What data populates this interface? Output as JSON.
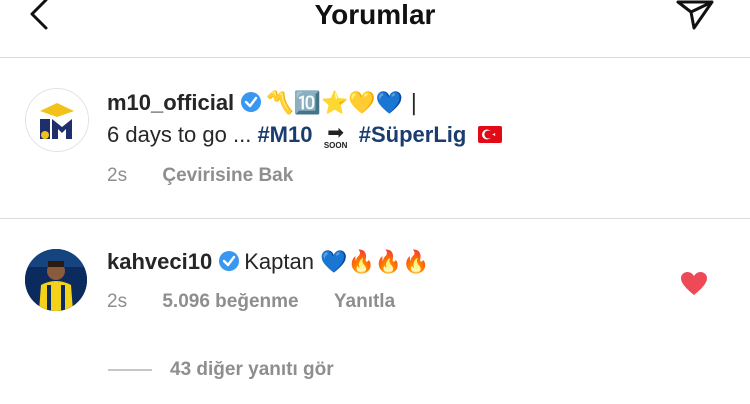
{
  "header": {
    "title": "Yorumlar",
    "back_icon": "chevron-left-icon",
    "send_icon": "paper-plane-icon"
  },
  "caption": {
    "username": "m10_official",
    "emojis_line1": "〽️🔟⭐💛💙 |",
    "text_prefix": "6 days to go ... ",
    "hashtag1": "#M10",
    "soon_label": "SOON",
    "hashtag2": "#SüperLig",
    "flag_icon": "turkey-flag-icon",
    "time": "2s",
    "translate_label": "Çevirisine Bak"
  },
  "reply": {
    "username": "kahveci10",
    "text": "Kaptan",
    "emojis": "💙🔥🔥🔥",
    "time": "2s",
    "likes_label": "5.096 beğenme",
    "reply_label": "Yanıtla",
    "liked": true,
    "heart_color": "#ed4956"
  },
  "view_replies_label": "43 diğer yanıtı gör",
  "colors": {
    "hashtag": "#1a3c6e",
    "verified": "#3897f0",
    "meta": "#8e8e8e"
  }
}
